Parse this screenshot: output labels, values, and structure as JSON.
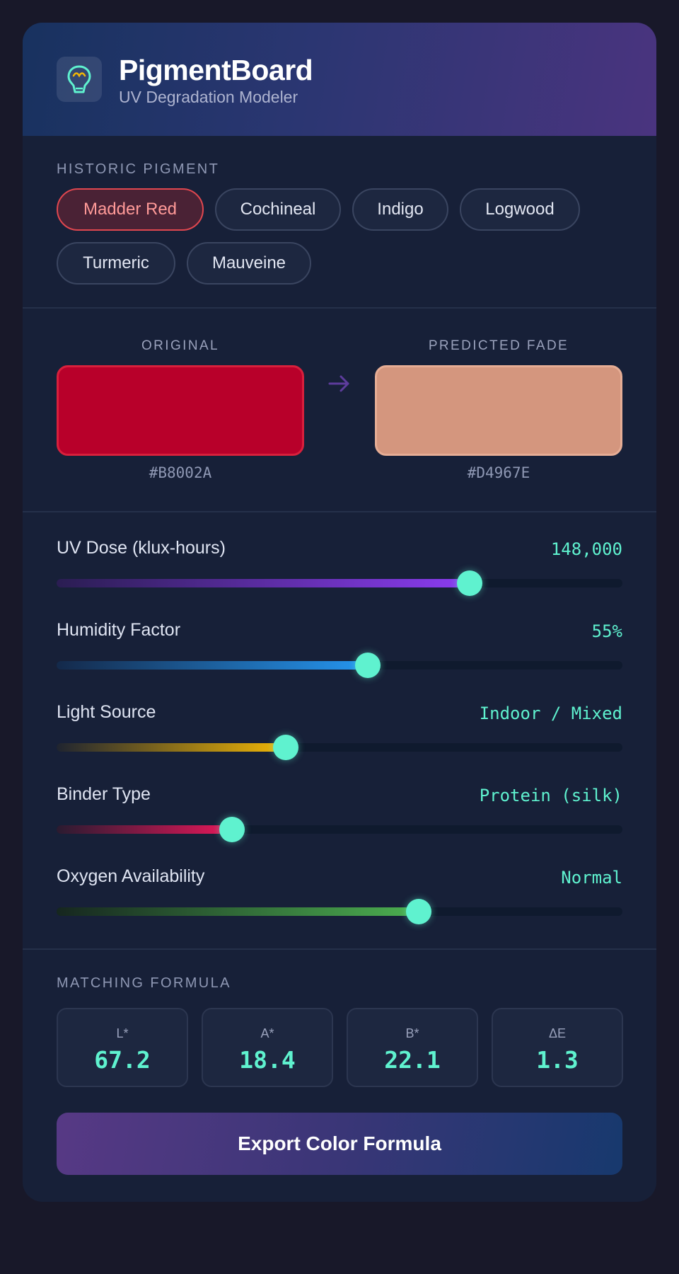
{
  "app": {
    "title": "PigmentBoard",
    "subtitle": "UV Degradation Modeler",
    "logo_icon": "lightbulb-icon"
  },
  "pigments": {
    "section_label": "HISTORIC PIGMENT",
    "items": [
      {
        "label": "Madder Red",
        "selected": true
      },
      {
        "label": "Cochineal",
        "selected": false
      },
      {
        "label": "Indigo",
        "selected": false
      },
      {
        "label": "Logwood",
        "selected": false
      },
      {
        "label": "Turmeric",
        "selected": false
      },
      {
        "label": "Mauveine",
        "selected": false
      }
    ]
  },
  "comparison": {
    "original": {
      "label": "ORIGINAL",
      "hex": "#B8002A",
      "color": "#B8002A"
    },
    "predicted": {
      "label": "PREDICTED FADE",
      "hex": "#D4967E",
      "color": "#D4967E"
    },
    "arrow_icon": "arrow-right-icon"
  },
  "sliders": [
    {
      "label": "UV Dose (klux-hours)",
      "value": "148,000",
      "level": 0.73,
      "fill": [
        "#2a1d52",
        "#8c3cf2"
      ]
    },
    {
      "label": "Humidity Factor",
      "value": "55%",
      "level": 0.55,
      "fill": [
        "#14294a",
        "#2596f0"
      ]
    },
    {
      "label": "Light Source",
      "value": "Indoor / Mixed",
      "level": 0.405,
      "fill": [
        "#1f2430",
        "#f2b705"
      ]
    },
    {
      "label": "Binder Type",
      "value": "Protein (silk)",
      "level": 0.31,
      "fill": [
        "#2a1b30",
        "#e6175a"
      ]
    },
    {
      "label": "Oxygen Availability",
      "value": "Normal",
      "level": 0.64,
      "fill": [
        "#16261f",
        "#4caf50"
      ]
    }
  ],
  "formula": {
    "section_label": "MATCHING FORMULA",
    "metrics": [
      {
        "label": "L*",
        "value": "67.2"
      },
      {
        "label": "A*",
        "value": "18.4"
      },
      {
        "label": "B*",
        "value": "22.1"
      },
      {
        "label": "ΔE",
        "value": "1.3"
      }
    ],
    "export_label": "Export Color Formula"
  },
  "colors": {
    "accent": "#5FF2CF",
    "selected_chip_border": "#E0474F",
    "background": "#172038"
  }
}
